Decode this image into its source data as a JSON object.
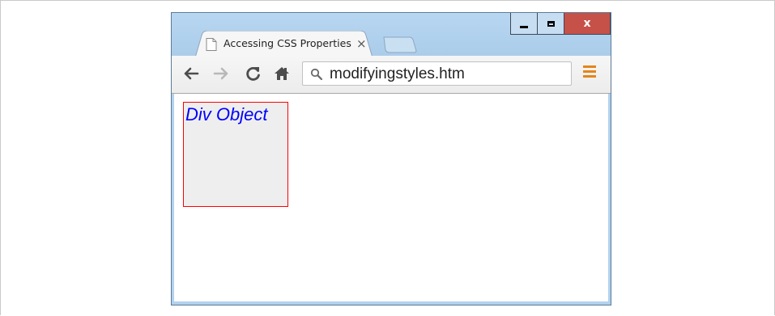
{
  "window": {
    "controls": {
      "minimize_icon": "minimize-icon",
      "maximize_icon": "maximize-icon",
      "close_label": "x"
    },
    "close_color": "#c65149"
  },
  "tab": {
    "title": "Accessing CSS Properties",
    "close_label": "×",
    "icon": "page-icon"
  },
  "toolbar": {
    "back_icon": "back-arrow-icon",
    "forward_icon": "forward-arrow-icon",
    "reload_icon": "reload-icon",
    "home_icon": "home-icon",
    "address": {
      "icon": "search-icon",
      "value": "modifyingstyles.htm"
    },
    "menu_icon": "hamburger-menu-icon",
    "menu_color": "#e4861b"
  },
  "page": {
    "div_object": {
      "text": "Div Object",
      "text_color": "#0000ff",
      "border_color": "#ff0000",
      "background": "#eeeeee"
    }
  }
}
